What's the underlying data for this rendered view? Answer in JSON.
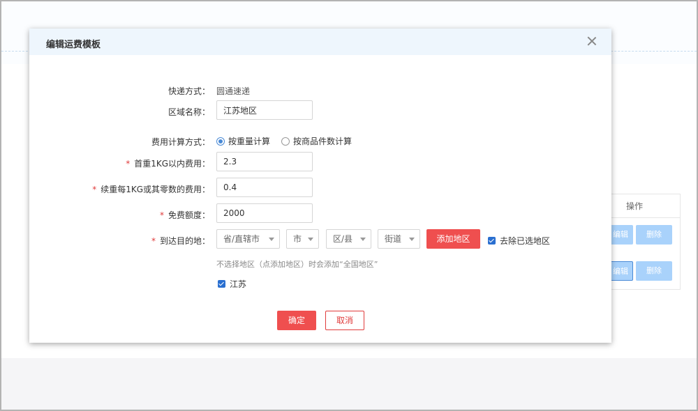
{
  "background": {
    "table_header": "操作",
    "edit_label": "编辑",
    "delete_label": "删除"
  },
  "modal": {
    "title": "编辑运费模板",
    "form": {
      "delivery": {
        "label": "快递方式：",
        "value": "圆通速递"
      },
      "region_name": {
        "label": "区域名称：",
        "value": "江苏地区"
      },
      "calc_method": {
        "label": "费用计算方式：",
        "options": [
          "按重量计算",
          "按商品件数计算"
        ],
        "selected": "按重量计算"
      },
      "first_weight_fee": {
        "required_mark": "*",
        "label": "首重1KG以内费用：",
        "value": "2.3"
      },
      "extra_weight_fee": {
        "required_mark": "*",
        "label": "续重每1KG或其零数的费用：",
        "value": "0.4"
      },
      "free_quota": {
        "required_mark": "*",
        "label": "免费额度：",
        "value": "2000"
      },
      "destination": {
        "required_mark": "*",
        "label": "到达目的地：",
        "province_placeholder": "省/直辖市",
        "city_placeholder": "市",
        "district_placeholder": "区/县",
        "street_placeholder": "街道",
        "add_button": "添加地区",
        "remove_selected_label": "去除已选地区",
        "remove_selected_checked": true,
        "hint": "不选择地区（点添加地区）时会添加“全国地区”",
        "selected_regions": [
          "江苏"
        ]
      }
    },
    "confirm_button": "确定",
    "cancel_button": "取消"
  }
}
